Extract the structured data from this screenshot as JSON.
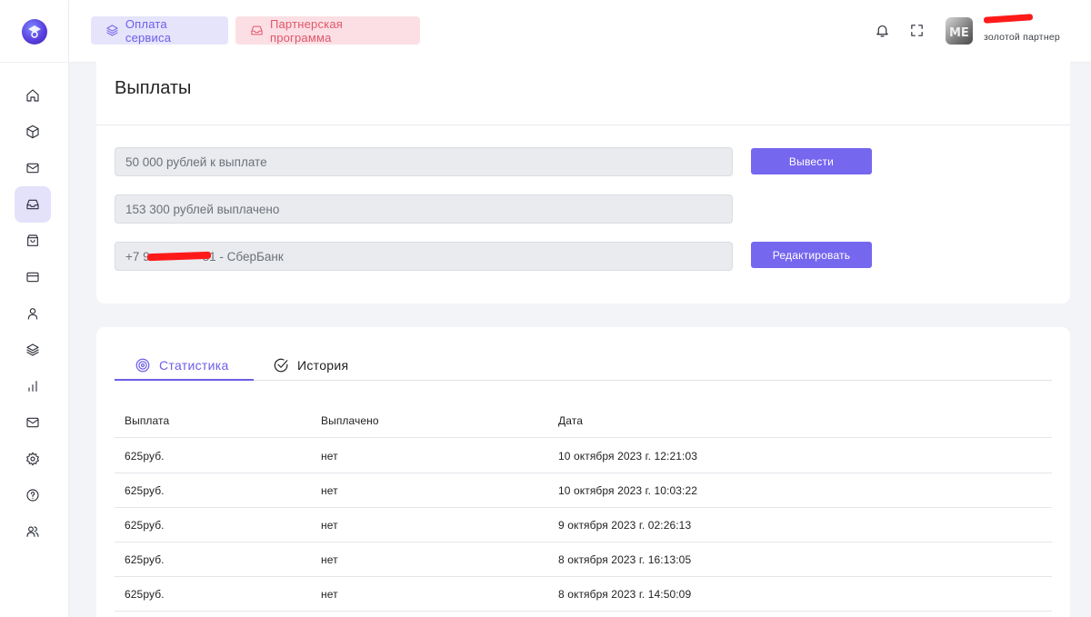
{
  "topbar": {
    "pay_button": "Оплата сервиса",
    "partner_button": "Партнерская программа",
    "user_role": "золотой партнер"
  },
  "sidebar": {
    "items": [
      {
        "icon": "home-icon"
      },
      {
        "icon": "box-icon"
      },
      {
        "icon": "mail-icon"
      },
      {
        "icon": "inbox-icon",
        "active": true
      },
      {
        "icon": "bag-icon"
      },
      {
        "icon": "card-icon"
      },
      {
        "icon": "user-icon"
      },
      {
        "icon": "layers-icon"
      },
      {
        "icon": "bar-chart-icon"
      },
      {
        "icon": "mail-icon"
      },
      {
        "icon": "settings-icon"
      },
      {
        "icon": "help-icon"
      },
      {
        "icon": "users-icon"
      }
    ]
  },
  "payouts": {
    "title": "Выплаты",
    "to_pay": "50 000 рублей к выплате",
    "paid": "153 300 рублей выплачено",
    "phone_prefix": "+7 9",
    "phone_suffix": "81 - СберБанк",
    "withdraw_button": "Вывести",
    "edit_button": "Редактировать"
  },
  "stats": {
    "tabs": [
      {
        "label": "Статистика",
        "active": true
      },
      {
        "label": "История",
        "active": false
      }
    ],
    "columns": [
      "Выплата",
      "Выплачено",
      "Дата"
    ],
    "rows": [
      [
        "625руб.",
        "нет",
        "10 октября 2023 г. 12:21:03"
      ],
      [
        "625руб.",
        "нет",
        "10 октября 2023 г. 10:03:22"
      ],
      [
        "625руб.",
        "нет",
        "9 октября 2023 г. 02:26:13"
      ],
      [
        "625руб.",
        "нет",
        "8 октября 2023 г. 16:13:05"
      ],
      [
        "625руб.",
        "нет",
        "8 октября 2023 г. 14:50:09"
      ]
    ]
  },
  "colors": {
    "accent": "#7667ef",
    "partner_pink": "#e1576c",
    "redaction": "#ff1a1a"
  }
}
